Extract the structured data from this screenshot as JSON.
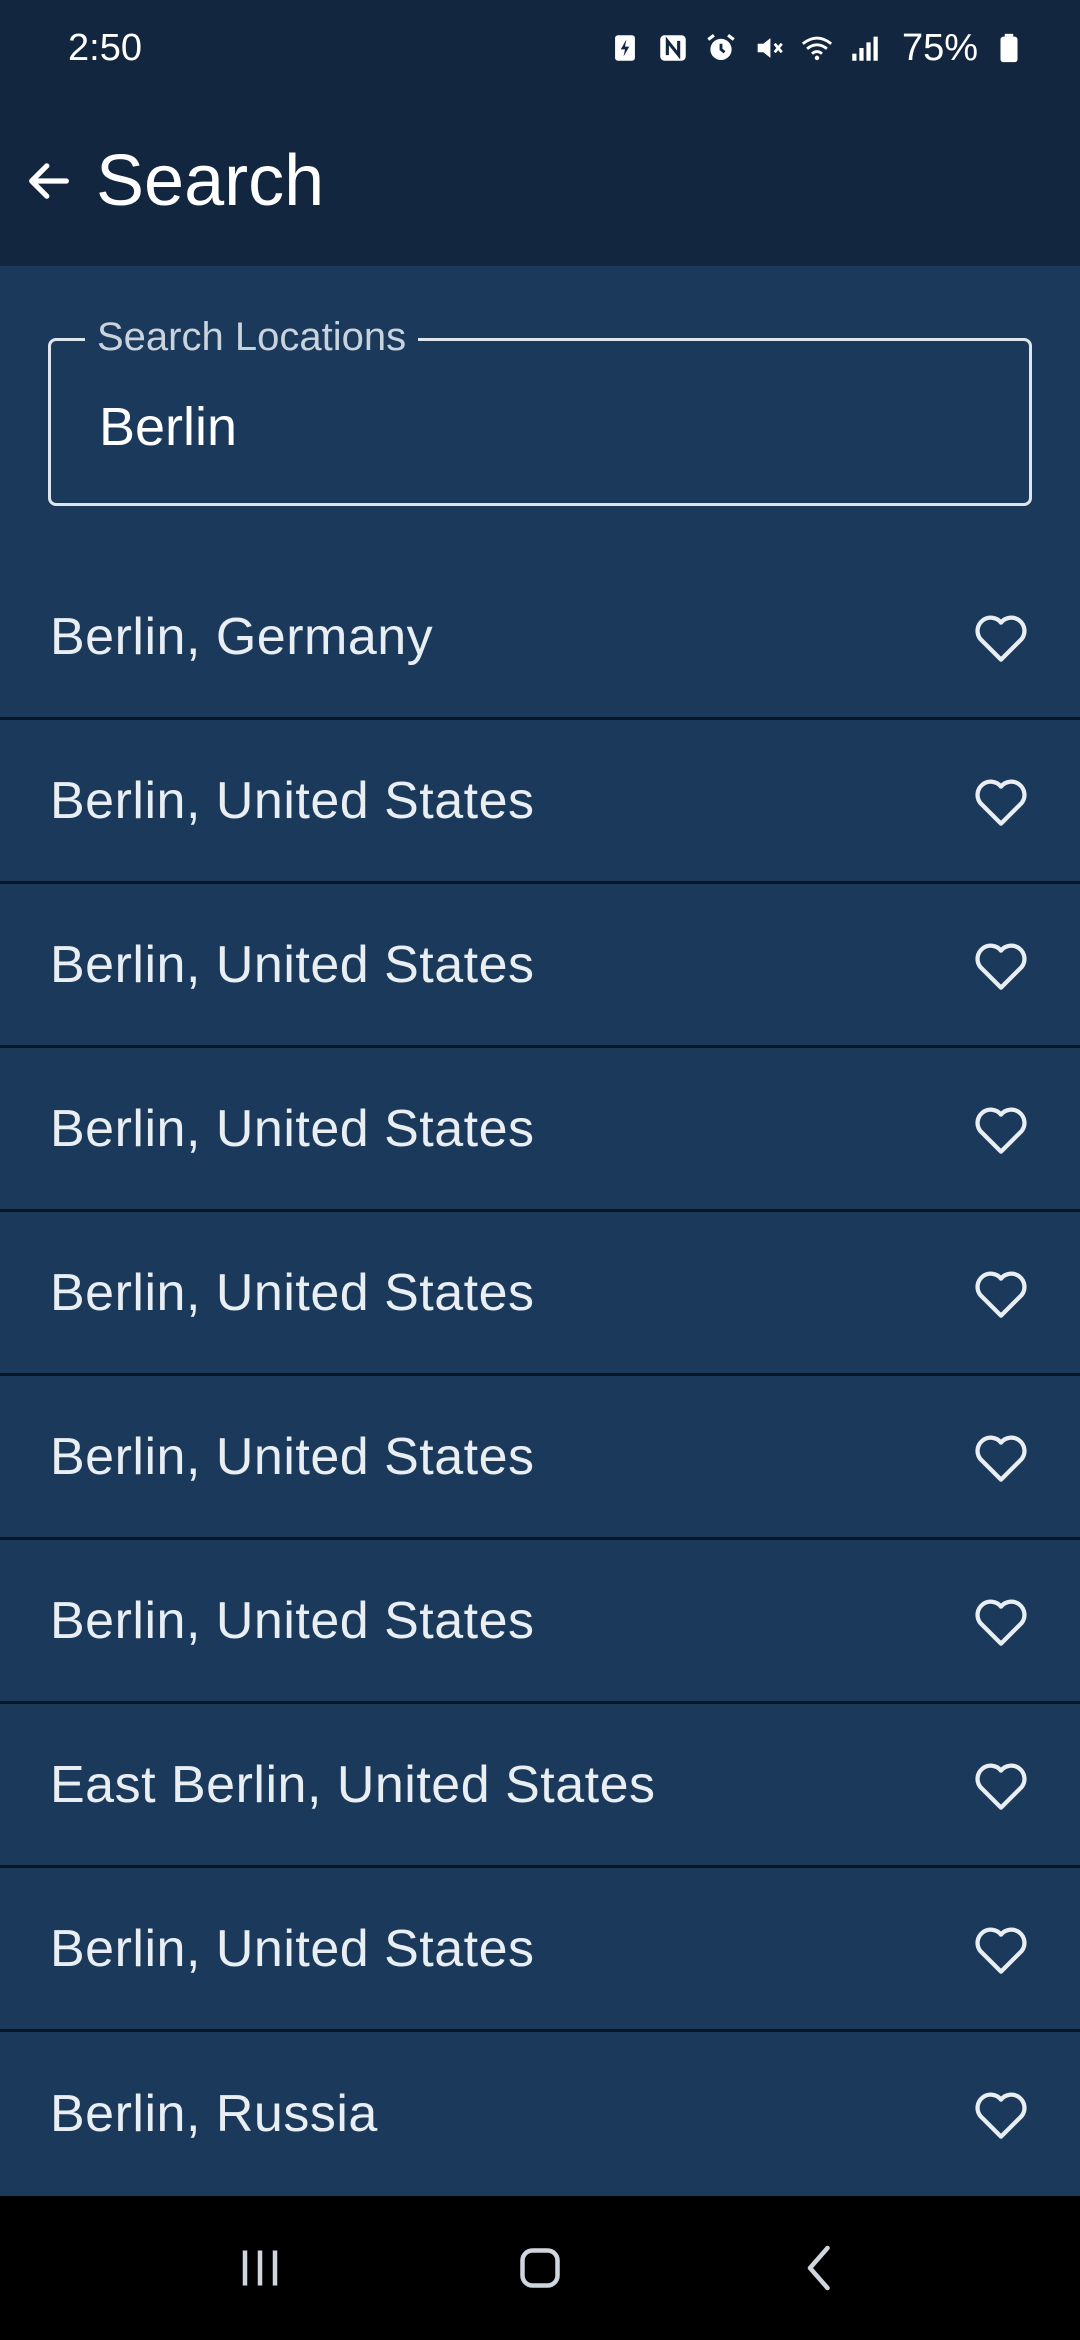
{
  "status_bar": {
    "time": "2:50",
    "battery_percent": "75%",
    "icons": [
      "battery-saver-icon",
      "nfc-icon",
      "alarm-icon",
      "mute-icon",
      "wifi-icon",
      "signal-icon",
      "battery-icon"
    ]
  },
  "app_bar": {
    "title": "Search",
    "back_icon": "arrow-left-icon"
  },
  "search": {
    "label": "Search Locations",
    "value": "Berlin",
    "placeholder": ""
  },
  "results": [
    {
      "label": "Berlin, Germany",
      "favorite": false
    },
    {
      "label": "Berlin, United States",
      "favorite": false
    },
    {
      "label": "Berlin, United States",
      "favorite": false
    },
    {
      "label": "Berlin, United States",
      "favorite": false
    },
    {
      "label": "Berlin, United States",
      "favorite": false
    },
    {
      "label": "Berlin, United States",
      "favorite": false
    },
    {
      "label": "Berlin, United States",
      "favorite": false
    },
    {
      "label": "East Berlin, United States",
      "favorite": false
    },
    {
      "label": "Berlin, United States",
      "favorite": false
    },
    {
      "label": "Berlin, Russia",
      "favorite": false
    }
  ],
  "nav_bar": {
    "buttons": [
      "recent-apps-icon",
      "home-icon",
      "back-icon"
    ]
  },
  "colors": {
    "app_bar": "#13263f",
    "background": "#1b3a5b",
    "divider": "#0b1726",
    "text": "#e9eef3"
  }
}
